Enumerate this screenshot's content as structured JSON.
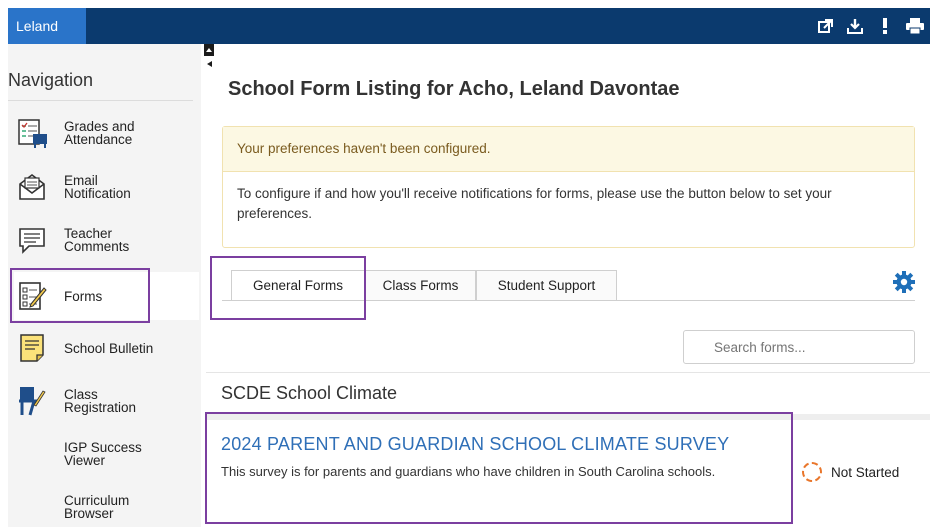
{
  "topbar": {
    "user_tab": "Leland",
    "icons": [
      "external-link-icon",
      "download-icon",
      "alert-icon",
      "print-icon"
    ],
    "color": "#0b3a6e",
    "accent": "#2a74c9"
  },
  "sidebar": {
    "title": "Navigation",
    "items": [
      {
        "label": "Grades and\nAttendance",
        "icon": "gradebook-icon"
      },
      {
        "label": "Email\nNotification",
        "icon": "envelope-icon"
      },
      {
        "label": "Teacher\nComments",
        "icon": "comment-icon"
      },
      {
        "label": "Forms",
        "icon": "forms-icon"
      },
      {
        "label": "School Bulletin",
        "icon": "bulletin-icon"
      },
      {
        "label": "Class\nRegistration",
        "icon": "desk-icon"
      },
      {
        "label": "IGP Success\nViewer",
        "icon": ""
      },
      {
        "label": "Curriculum\nBrowser",
        "icon": ""
      }
    ]
  },
  "main": {
    "title": "School Form Listing for Acho, Leland Davontae",
    "alert": {
      "heading": "Your preferences haven't been configured.",
      "body": "To configure if and how you'll receive notifications for forms, please use the button below to set your preferences."
    },
    "tabs": [
      "General Forms",
      "Class Forms",
      "Student Support"
    ],
    "search_placeholder": "Search forms...",
    "section_title": "SCDE School Climate",
    "form": {
      "title": "2024 PARENT AND GUARDIAN SCHOOL CLIMATE SURVEY",
      "description": "This survey is for parents and guardians who have children in South Carolina schools.",
      "status": "Not Started"
    }
  },
  "colors": {
    "highlight": "#7b3fa0",
    "link": "#2f6fb7",
    "status_ring": "#e9762b",
    "alert_bg": "#fcf8e3"
  }
}
